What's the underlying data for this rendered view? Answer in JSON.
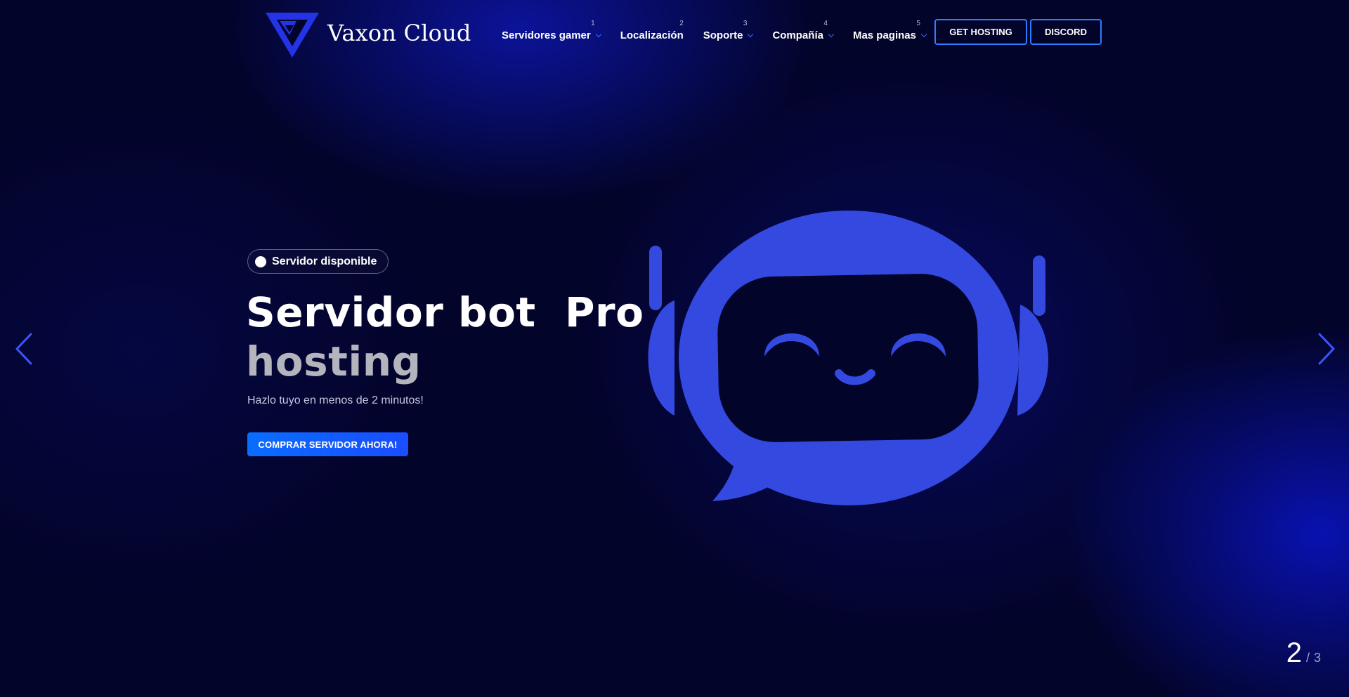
{
  "header": {
    "brand": "Vaxon Cloud",
    "nav": [
      {
        "label": "Servidores gamer",
        "number": "1",
        "has_dropdown": true
      },
      {
        "label": "Localización",
        "number": "2",
        "has_dropdown": false
      },
      {
        "label": "Soporte",
        "number": "3",
        "has_dropdown": true
      },
      {
        "label": "Compañía",
        "number": "4",
        "has_dropdown": true
      },
      {
        "label": "Mas paginas",
        "number": "5",
        "has_dropdown": true
      }
    ],
    "buttons": {
      "hosting": "GET HOSTING",
      "discord": "DISCORD"
    }
  },
  "hero": {
    "badge": "Servidor disponible",
    "title_line1": "Servidor bot  Pro",
    "title_line2": "hosting",
    "subtitle": "Hazlo tuyo en menos de 2 minutos!",
    "cta": "COMPRAR SERVIDOR AHORA!"
  },
  "slider": {
    "current": "2",
    "separator": "/",
    "total": "3"
  },
  "icons": {
    "logo": "vaxon-v-logo-icon",
    "illustration": "robot-chat-bubble-icon",
    "prev": "chevron-left-icon",
    "next": "chevron-right-icon",
    "dropdown": "chevron-down-icon"
  },
  "colors": {
    "background": "#03042a",
    "accent": "#2d7dff",
    "robot": "#3449e0",
    "cta": "#0a6dff"
  }
}
